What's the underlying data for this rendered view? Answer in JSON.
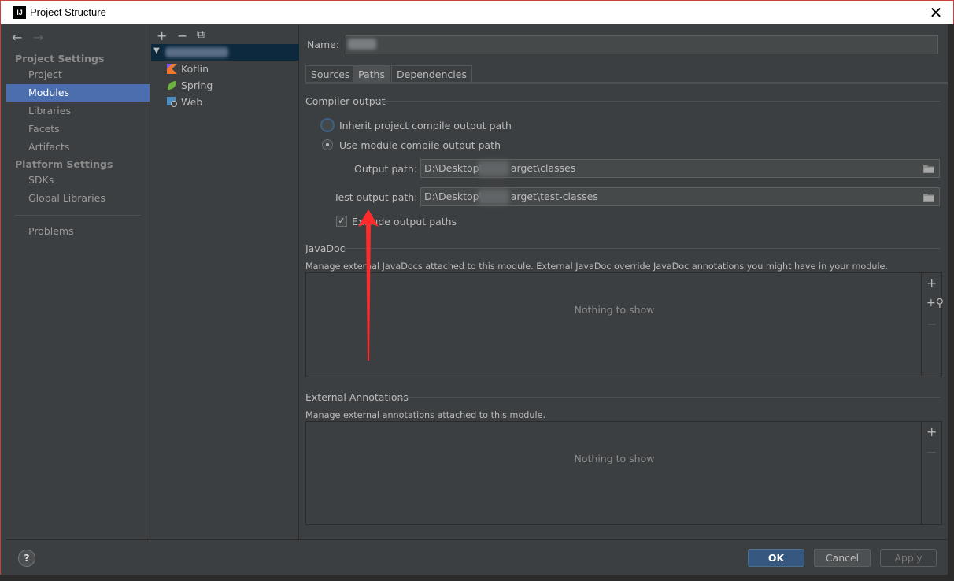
{
  "window": {
    "title": "Project Structure",
    "app_icon_text": "IJ"
  },
  "nav": {
    "back_glyph": "←",
    "forward_glyph": "→",
    "project_settings_header": "Project Settings",
    "project_settings_items": [
      "Project",
      "Modules",
      "Libraries",
      "Facets",
      "Artifacts"
    ],
    "platform_settings_header": "Platform Settings",
    "platform_settings_items": [
      "SDKs",
      "Global Libraries"
    ],
    "problems": "Problems",
    "selected": "Modules"
  },
  "tree": {
    "toolbar": {
      "add": "+",
      "remove": "−",
      "copy": "⧉"
    },
    "children": [
      {
        "label": "Kotlin",
        "icon": "kotlin-icon",
        "color": "#f0752f"
      },
      {
        "label": "Spring",
        "icon": "spring-leaf-icon",
        "color": "#6cb33e"
      },
      {
        "label": "Web",
        "icon": "web-module-icon",
        "color": "#4b8bbe"
      }
    ]
  },
  "content": {
    "name_label": "Name:",
    "tabs": [
      "Sources",
      "Paths",
      "Dependencies"
    ],
    "selected_tab": "Paths",
    "compiler_output": {
      "title": "Compiler output",
      "inherit_label": "Inherit project compile output path",
      "use_module_label": "Use module compile output path",
      "selected_option": "use_module",
      "output_path_label": "Output path:",
      "output_path_value_start": "D:\\Desktop\\",
      "output_path_value_end": "arget\\classes",
      "test_output_path_label": "Test output path:",
      "test_output_path_value_start": "D:\\Desktop\\",
      "test_output_path_value_end": "arget\\test-classes",
      "exclude_label": "Exclude output paths",
      "exclude_checked": true
    },
    "javadoc": {
      "title": "JavaDoc",
      "description": "Manage external JavaDocs attached to this module. External JavaDoc override JavaDoc annotations you might have in your module.",
      "empty": "Nothing to show"
    },
    "external_annotations": {
      "title": "External Annotations",
      "description": "Manage external annotations attached to this module.",
      "empty": "Nothing to show"
    }
  },
  "footer": {
    "help": "?",
    "ok": "OK",
    "cancel": "Cancel",
    "apply": "Apply"
  },
  "colors": {
    "accent": "#4b6eaf",
    "annotation_arrow": "#ff2a2a"
  }
}
